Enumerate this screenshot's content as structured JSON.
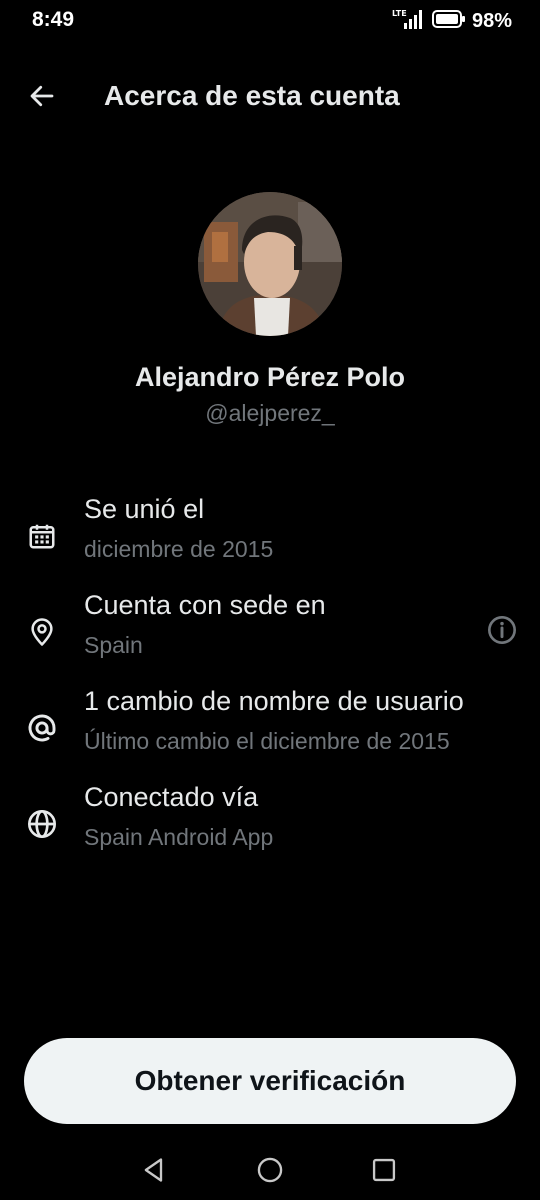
{
  "status_bar": {
    "time": "8:49",
    "network": "LTE",
    "battery": "98%"
  },
  "header": {
    "back_icon": "arrow-left-icon",
    "title": "Acerca de esta cuenta"
  },
  "profile": {
    "name": "Alejandro Pérez Polo",
    "handle": "@alejperez_"
  },
  "info": [
    {
      "icon": "calendar-icon",
      "title": "Se unió el",
      "subtitle": "diciembre de 2015"
    },
    {
      "icon": "location-pin-icon",
      "title": "Cuenta con sede en",
      "subtitle": "Spain",
      "extra_icon": "info-icon"
    },
    {
      "icon": "at-sign-icon",
      "title": "1 cambio de nombre de usuario",
      "subtitle": "Último cambio el diciembre de 2015"
    },
    {
      "icon": "globe-icon",
      "title": "Conectado vía",
      "subtitle": "Spain Android App"
    }
  ],
  "verify_button": {
    "label": "Obtener verificación"
  },
  "nav_bar": {
    "items": [
      "back-triangle-icon",
      "home-circle-icon",
      "recents-square-icon"
    ]
  },
  "colors": {
    "background": "#000000",
    "primary_text": "#e7e9ea",
    "secondary_text": "#71767b",
    "button_bg": "#eff3f4",
    "button_text": "#0f1419"
  }
}
